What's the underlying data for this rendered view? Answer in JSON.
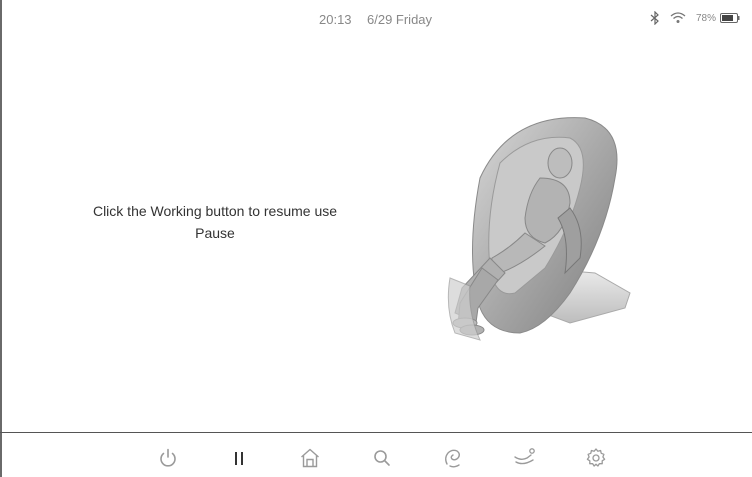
{
  "status_bar": {
    "time": "20:13",
    "date": "6/29 Friday",
    "battery_percent": "78%",
    "icons": [
      "bluetooth-icon",
      "wifi-icon",
      "battery-icon"
    ]
  },
  "main": {
    "message_line1": "Click the Working button to resume use",
    "message_line2": "Pause",
    "illustration": "massage-chair-image"
  },
  "nav": {
    "items": [
      {
        "name": "power",
        "icon": "power-icon"
      },
      {
        "name": "pause",
        "icon": "pause-icon"
      },
      {
        "name": "home",
        "icon": "home-icon"
      },
      {
        "name": "search",
        "icon": "search-icon"
      },
      {
        "name": "massage",
        "icon": "massage-icon"
      },
      {
        "name": "recline",
        "icon": "recline-icon"
      },
      {
        "name": "settings",
        "icon": "gear-icon"
      }
    ]
  },
  "colors": {
    "icon": "#9a9a9a",
    "text": "#333333",
    "status_text": "#888888",
    "divider": "#555555"
  }
}
